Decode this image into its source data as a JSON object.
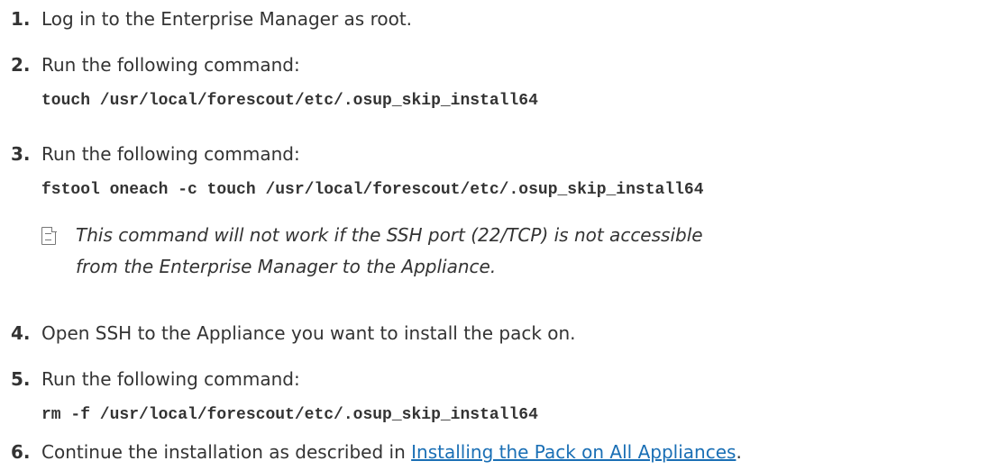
{
  "steps": [
    {
      "number": "1.",
      "text": "Log in to the Enterprise Manager as root."
    },
    {
      "number": "2.",
      "text": "Run the following command:",
      "command": "touch /usr/local/forescout/etc/.osup_skip_install64"
    },
    {
      "number": "3.",
      "text": "Run the following command:",
      "command": "fstool oneach -c touch /usr/local/forescout/etc/.osup_skip_install64"
    },
    {
      "number": "4.",
      "text": "Open SSH to the Appliance you want to install the pack on."
    },
    {
      "number": "5.",
      "text": "Run the following command:",
      "command": "rm -f /usr/local/forescout/etc/.osup_skip_install64"
    },
    {
      "number": "6.",
      "text_before": "Continue the installation as described in ",
      "link": "Installing the Pack on All Appliances",
      "text_after": "."
    }
  ],
  "note": {
    "icon": "note-icon",
    "line1": "This command will not work if the SSH port (22/TCP) is not accessible",
    "line2": "from the Enterprise Manager to the Appliance."
  },
  "colors": {
    "text": "#333333",
    "link": "#1a6fb5"
  }
}
